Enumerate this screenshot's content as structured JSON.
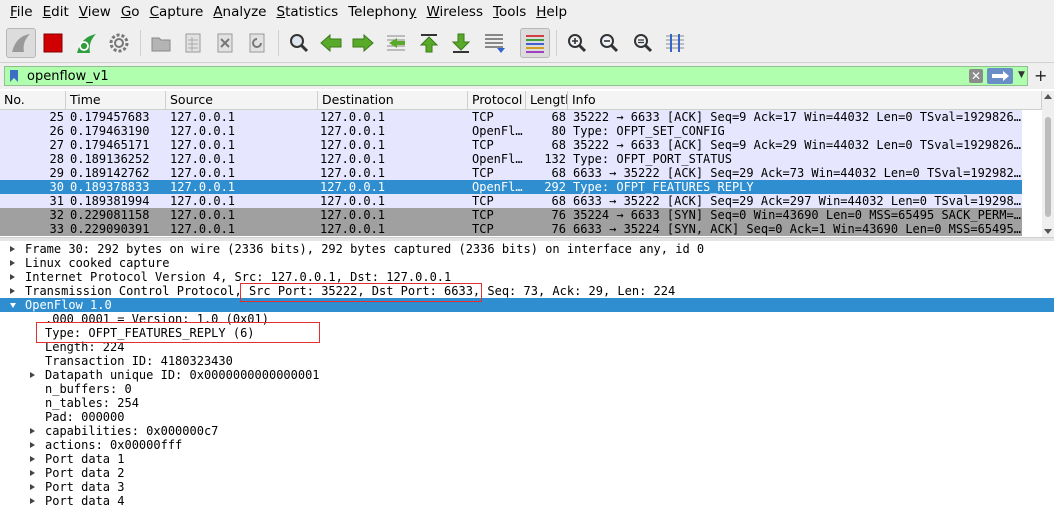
{
  "menubar": {
    "items": [
      {
        "label": "File",
        "u": "F",
        "rest": "ile"
      },
      {
        "label": "Edit",
        "u": "E",
        "rest": "dit"
      },
      {
        "label": "View",
        "u": "V",
        "rest": "iew"
      },
      {
        "label": "Go",
        "u": "G",
        "rest": "o"
      },
      {
        "label": "Capture",
        "u": "C",
        "rest": "apture"
      },
      {
        "label": "Analyze",
        "u": "A",
        "rest": "nalyze"
      },
      {
        "label": "Statistics",
        "u": "S",
        "rest": "tatistics"
      },
      {
        "label": "Telephony",
        "u": "y",
        "pre": "Telephon",
        "rest": ""
      },
      {
        "label": "Wireless",
        "u": "W",
        "rest": "ireless"
      },
      {
        "label": "Tools",
        "u": "T",
        "rest": "ools"
      },
      {
        "label": "Help",
        "u": "H",
        "rest": "elp"
      }
    ]
  },
  "filter": {
    "value": "openflow_v1",
    "bg_color": "#afffaf"
  },
  "packet_list": {
    "columns": [
      "No.",
      "Time",
      "Source",
      "Destination",
      "Protocol",
      "Length",
      "Info"
    ],
    "rows": [
      {
        "no": "25",
        "time": "0.179457683",
        "src": "127.0.0.1",
        "dst": "127.0.0.1",
        "proto": "TCP",
        "len": "68",
        "info": "35222 → 6633 [ACK] Seq=9 Ack=17 Win=44032 Len=0 TSval=1929826…",
        "kind": "tcp"
      },
      {
        "no": "26",
        "time": "0.179463190",
        "src": "127.0.0.1",
        "dst": "127.0.0.1",
        "proto": "OpenFl…",
        "len": "80",
        "info": "Type: OFPT_SET_CONFIG",
        "kind": "of"
      },
      {
        "no": "27",
        "time": "0.179465171",
        "src": "127.0.0.1",
        "dst": "127.0.0.1",
        "proto": "TCP",
        "len": "68",
        "info": "35222 → 6633 [ACK] Seq=9 Ack=29 Win=44032 Len=0 TSval=1929826…",
        "kind": "tcp"
      },
      {
        "no": "28",
        "time": "0.189136252",
        "src": "127.0.0.1",
        "dst": "127.0.0.1",
        "proto": "OpenFl…",
        "len": "132",
        "info": "Type: OFPT_PORT_STATUS",
        "kind": "of"
      },
      {
        "no": "29",
        "time": "0.189142762",
        "src": "127.0.0.1",
        "dst": "127.0.0.1",
        "proto": "TCP",
        "len": "68",
        "info": "6633 → 35222 [ACK] Seq=29 Ack=73 Win=44032 Len=0 TSval=192982…",
        "kind": "tcp"
      },
      {
        "no": "30",
        "time": "0.189378833",
        "src": "127.0.0.1",
        "dst": "127.0.0.1",
        "proto": "OpenFl…",
        "len": "292",
        "info": "Type: OFPT_FEATURES_REPLY",
        "kind": "sel"
      },
      {
        "no": "31",
        "time": "0.189381994",
        "src": "127.0.0.1",
        "dst": "127.0.0.1",
        "proto": "TCP",
        "len": "68",
        "info": "6633 → 35222 [ACK] Seq=29 Ack=297 Win=44032 Len=0 TSval=19298…",
        "kind": "tcp"
      },
      {
        "no": "32",
        "time": "0.229081158",
        "src": "127.0.0.1",
        "dst": "127.0.0.1",
        "proto": "TCP",
        "len": "76",
        "info": "35224 → 6633 [SYN] Seq=0 Win=43690 Len=0 MSS=65495 SACK_PERM=…",
        "kind": "syn"
      },
      {
        "no": "33",
        "time": "0.229090391",
        "src": "127.0.0.1",
        "dst": "127.0.0.1",
        "proto": "TCP",
        "len": "76",
        "info": "6633 → 35224 [SYN, ACK] Seq=0 Ack=1 Win=43690 Len=0 MSS=65495…",
        "kind": "syn"
      }
    ]
  },
  "detail": {
    "rows": [
      {
        "text": "Frame 30: 292 bytes on wire (2336 bits), 292 bytes captured (2336 bits) on interface any, id 0",
        "indent": 0,
        "expander": true
      },
      {
        "text": "Linux cooked capture",
        "indent": 0,
        "expander": true
      },
      {
        "text": "Internet Protocol Version 4, Src: 127.0.0.1, Dst: 127.0.0.1",
        "indent": 0,
        "expander": true
      },
      {
        "text": "Transmission Control Protocol, Src Port: 35222, Dst Port: 6633, Seq: 73, Ack: 29, Len: 224",
        "indent": 0,
        "expander": true
      },
      {
        "text": "OpenFlow 1.0",
        "indent": 0,
        "expander": true,
        "selected": true
      },
      {
        "text": ".000 0001 = Version: 1.0 (0x01)",
        "indent": 1,
        "expander": false
      },
      {
        "text": "Type: OFPT_FEATURES_REPLY (6)",
        "indent": 1,
        "expander": false
      },
      {
        "text": "Length: 224",
        "indent": 1,
        "expander": false
      },
      {
        "text": "Transaction ID: 4180323430",
        "indent": 1,
        "expander": false
      },
      {
        "text": "Datapath unique ID: 0x0000000000000001",
        "indent": 1,
        "expander": true
      },
      {
        "text": "n_buffers: 0",
        "indent": 1,
        "expander": false
      },
      {
        "text": "n_tables: 254",
        "indent": 1,
        "expander": false
      },
      {
        "text": "Pad: 000000",
        "indent": 1,
        "expander": false
      },
      {
        "text": "capabilities: 0x000000c7",
        "indent": 1,
        "expander": true
      },
      {
        "text": "actions: 0x00000fff",
        "indent": 1,
        "expander": true
      },
      {
        "text": "Port data 1",
        "indent": 1,
        "expander": true
      },
      {
        "text": "Port data 2",
        "indent": 1,
        "expander": true
      },
      {
        "text": "Port data 3",
        "indent": 1,
        "expander": true
      },
      {
        "text": "Port data 4",
        "indent": 1,
        "expander": true
      }
    ]
  },
  "colors": {
    "selected_row": "#2e8ed0",
    "tcp_row": "#e7e6ff",
    "syn_row": "#a0a0a0",
    "annotation_box": "#e03030"
  }
}
